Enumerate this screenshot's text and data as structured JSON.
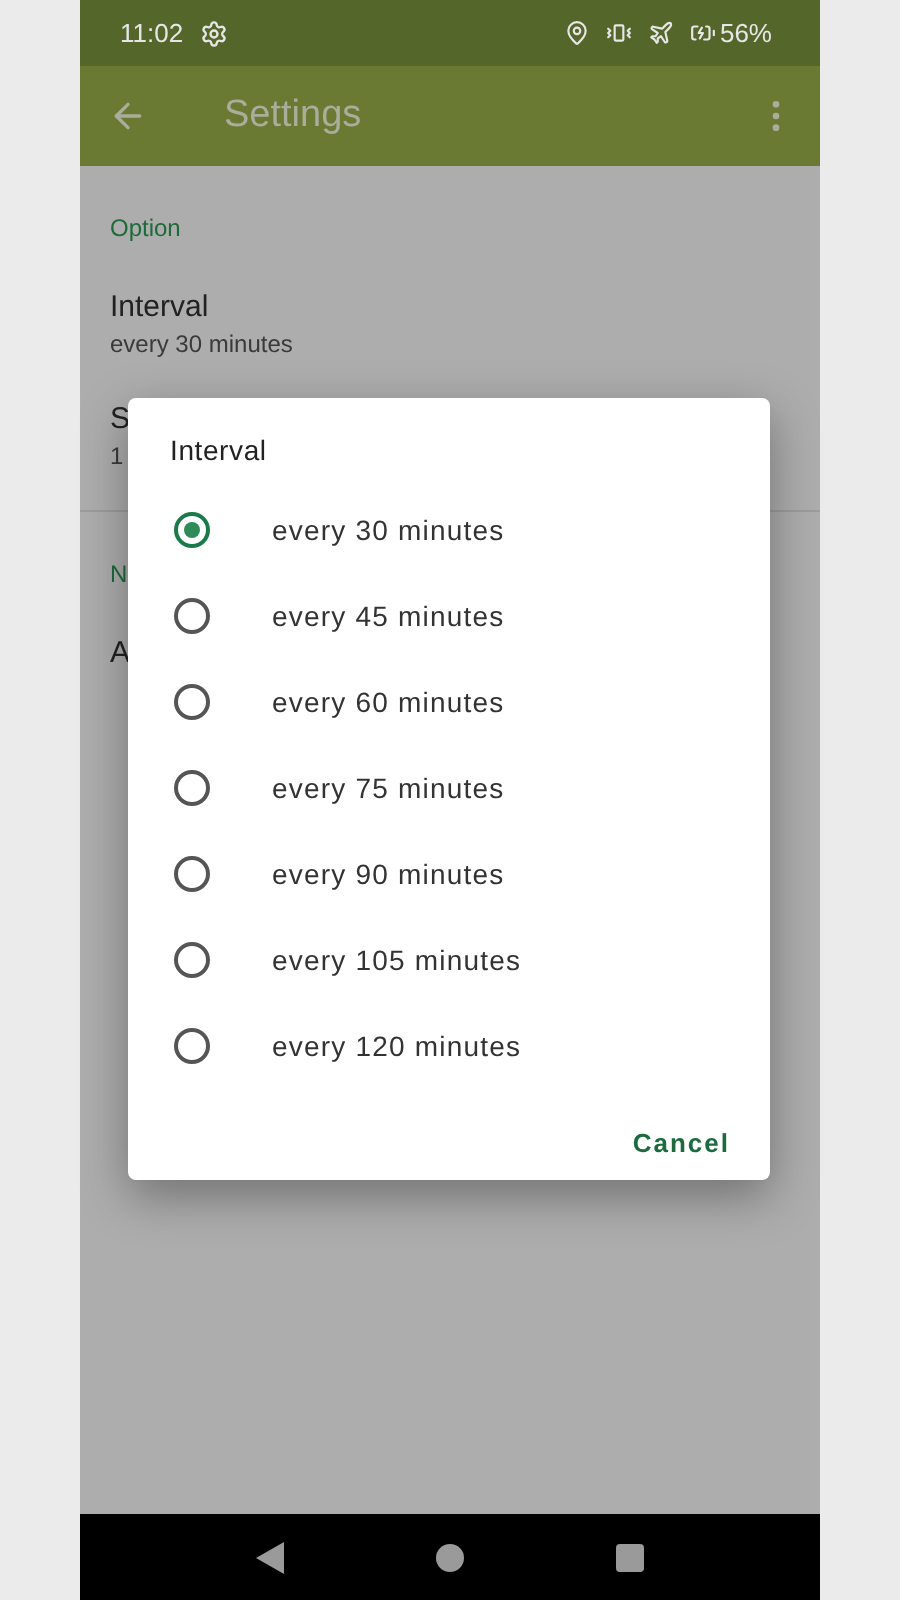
{
  "status_bar": {
    "time": "11:02",
    "battery": "56%"
  },
  "app_bar": {
    "title": "Settings"
  },
  "sections": [
    {
      "header": "Option",
      "items": [
        {
          "title": "Interval",
          "summary": "every 30 minutes"
        },
        {
          "title": "S",
          "summary": "1"
        }
      ]
    },
    {
      "header": "N",
      "items": [
        {
          "title": "A"
        }
      ]
    }
  ],
  "dialog": {
    "title": "Interval",
    "options": [
      {
        "label": "every 30 minutes",
        "selected": true
      },
      {
        "label": "every 45 minutes",
        "selected": false
      },
      {
        "label": "every 60 minutes",
        "selected": false
      },
      {
        "label": "every 75 minutes",
        "selected": false
      },
      {
        "label": "every 90 minutes",
        "selected": false
      },
      {
        "label": "every 105 minutes",
        "selected": false
      },
      {
        "label": "every 120 minutes",
        "selected": false
      }
    ],
    "button": "Cancel"
  }
}
